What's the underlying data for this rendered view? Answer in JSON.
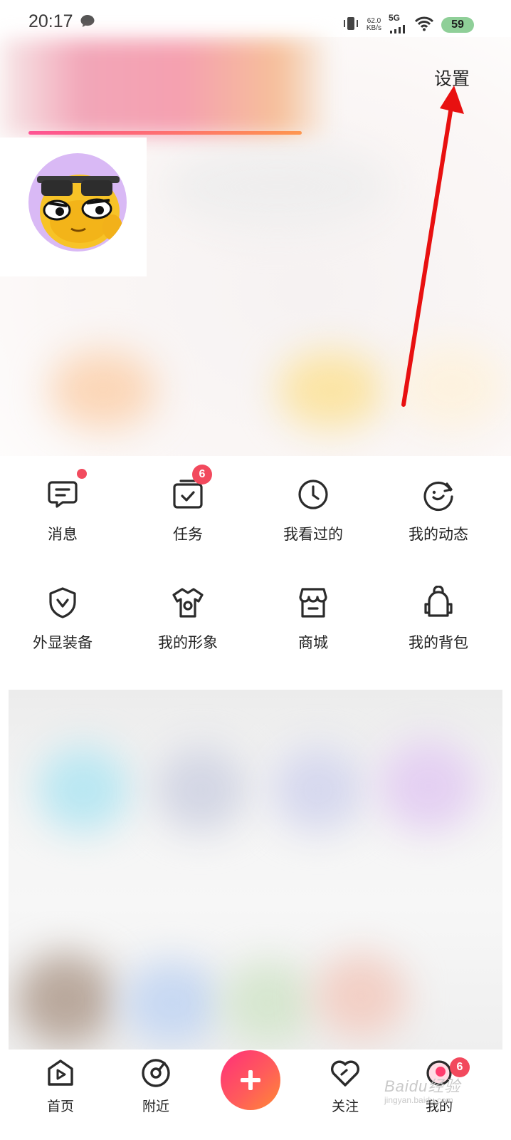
{
  "status_bar": {
    "time": "20:17",
    "net_speed_value": "62.0",
    "net_speed_unit": "KB/s",
    "network": "5G",
    "battery": "59"
  },
  "header": {
    "settings_label": "设置"
  },
  "menu": {
    "items": [
      {
        "label": "消息",
        "icon": "message-icon",
        "dot": true
      },
      {
        "label": "任务",
        "icon": "task-icon",
        "badge": "6"
      },
      {
        "label": "我看过的",
        "icon": "history-clock-icon"
      },
      {
        "label": "我的动态",
        "icon": "moments-icon"
      },
      {
        "label": "外显装备",
        "icon": "shield-badge-icon"
      },
      {
        "label": "我的形象",
        "icon": "outfit-shirt-icon"
      },
      {
        "label": "商城",
        "icon": "store-icon"
      },
      {
        "label": "我的背包",
        "icon": "backpack-icon"
      }
    ]
  },
  "bottom_nav": {
    "items": [
      {
        "label": "首页",
        "icon": "home-play-icon"
      },
      {
        "label": "附近",
        "icon": "nearby-icon"
      },
      {
        "label": "",
        "icon": "plus-icon"
      },
      {
        "label": "关注",
        "icon": "heart-icon"
      },
      {
        "label": "我的",
        "icon": "profile-icon",
        "badge": "6"
      }
    ]
  },
  "watermark": {
    "text": "Baidu经验",
    "sub": "jingyan.baidu.com"
  },
  "colors": {
    "accent_pink": "#ff2f7a",
    "accent_orange": "#ff8a34",
    "badge_red": "#f2495d",
    "annotation_arrow": "#e81010"
  }
}
